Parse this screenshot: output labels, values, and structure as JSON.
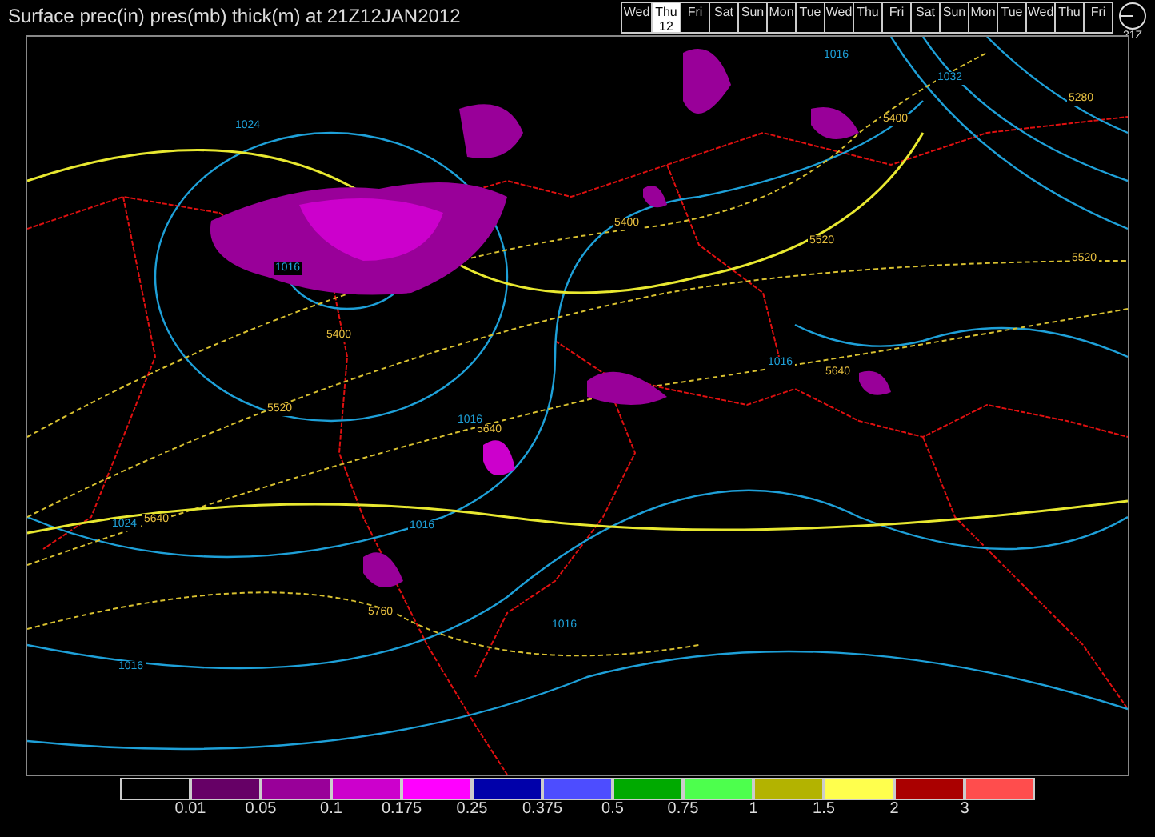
{
  "title": "Surface prec(in) pres(mb) thick(m) at 21Z12JAN2012",
  "days": [
    {
      "label": "Wed",
      "selected": false
    },
    {
      "label": "Thu",
      "date": "12",
      "selected": true
    },
    {
      "label": "Fri",
      "selected": false
    },
    {
      "label": "Sat",
      "selected": false
    },
    {
      "label": "Sun",
      "selected": false
    },
    {
      "label": "Mon",
      "selected": false
    },
    {
      "label": "Tue",
      "selected": false
    },
    {
      "label": "Wed",
      "selected": false
    },
    {
      "label": "Thu",
      "selected": false
    },
    {
      "label": "Fri",
      "selected": false
    },
    {
      "label": "Sat",
      "selected": false
    },
    {
      "label": "Sun",
      "selected": false
    },
    {
      "label": "Mon",
      "selected": false
    },
    {
      "label": "Tue",
      "selected": false
    },
    {
      "label": "Wed",
      "selected": false
    },
    {
      "label": "Thu",
      "selected": false
    },
    {
      "label": "Fri",
      "selected": false
    }
  ],
  "clock_label": "21Z",
  "map_labels": [
    {
      "text": "1024",
      "kind": "pressure"
    },
    {
      "text": "1016",
      "kind": "pressure"
    },
    {
      "text": "5400",
      "kind": "thickness"
    },
    {
      "text": "5520",
      "kind": "thickness"
    },
    {
      "text": "1024",
      "kind": "pressure"
    },
    {
      "text": "5640",
      "kind": "thickness"
    },
    {
      "text": "1016",
      "kind": "pressure"
    },
    {
      "text": "5640",
      "kind": "thickness"
    },
    {
      "text": "1016",
      "kind": "pressure"
    },
    {
      "text": "1016",
      "kind": "pressure"
    },
    {
      "text": "5760",
      "kind": "thickness"
    },
    {
      "text": "1016",
      "kind": "pressure"
    },
    {
      "text": "1016",
      "kind": "pressure"
    },
    {
      "text": "1032",
      "kind": "pressure"
    },
    {
      "text": "5280",
      "kind": "thickness"
    },
    {
      "text": "5400",
      "kind": "thickness"
    },
    {
      "text": "5400",
      "kind": "thickness"
    },
    {
      "text": "5520",
      "kind": "thickness"
    },
    {
      "text": "5520",
      "kind": "thickness"
    },
    {
      "text": "1016",
      "kind": "pressure"
    },
    {
      "text": "5640",
      "kind": "thickness"
    }
  ],
  "legend": [
    {
      "color": "#000000"
    },
    {
      "color": "#660066",
      "label": "0.01"
    },
    {
      "color": "#990099",
      "label": "0.05"
    },
    {
      "color": "#cc00cc",
      "label": "0.1"
    },
    {
      "color": "#ff00ff",
      "label": "0.175"
    },
    {
      "color": "#0000aa",
      "label": "0.25"
    },
    {
      "color": "#4d4dff",
      "label": "0.375"
    },
    {
      "color": "#00aa00",
      "label": "0.5"
    },
    {
      "color": "#4dff4d",
      "label": "0.75"
    },
    {
      "color": "#b3b300",
      "label": "1"
    },
    {
      "color": "#ffff4d",
      "label": "1.5"
    },
    {
      "color": "#aa0000",
      "label": "2"
    },
    {
      "color": "#ff4d4d",
      "label": "3"
    }
  ]
}
